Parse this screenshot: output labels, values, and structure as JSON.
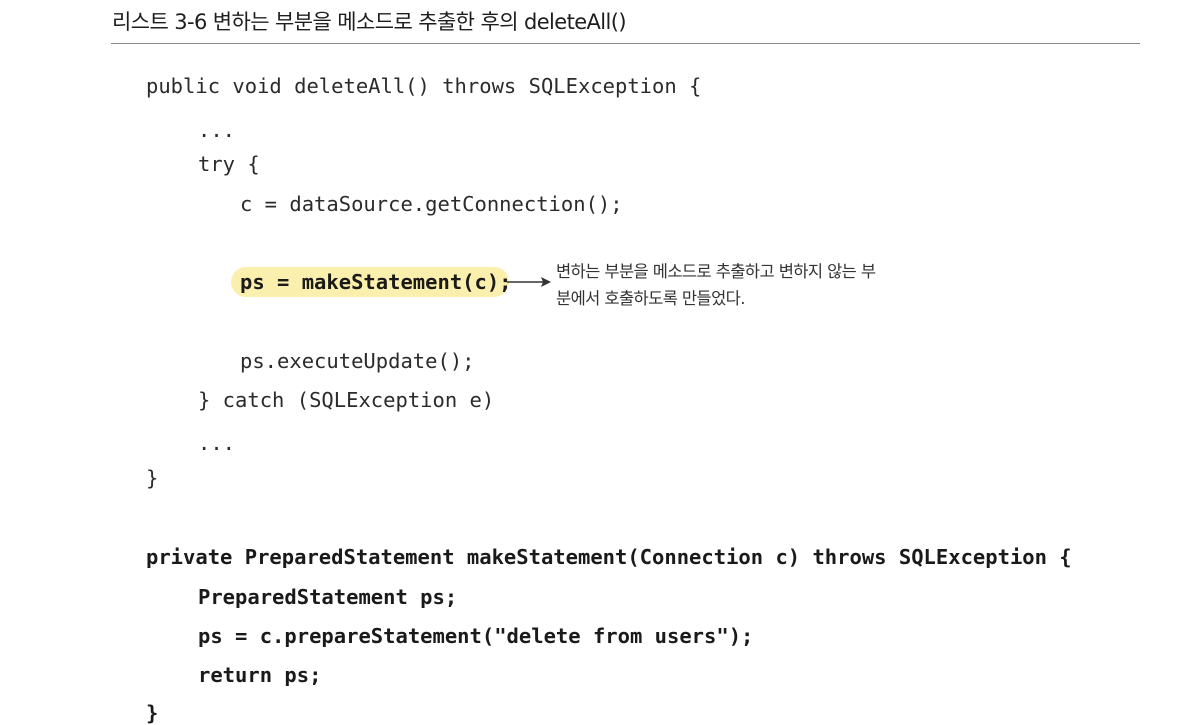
{
  "listing": {
    "title": "리스트 3-6 변하는 부분을 메소드로 추출한 후의 deleteAll()"
  },
  "code": {
    "delete_all": {
      "signature": "public void deleteAll() throws SQLException {",
      "ellipsis_1": "...",
      "try_open": "try {",
      "get_connection": "c = dataSource.getConnection();",
      "make_statement": "ps = makeStatement(c);",
      "execute_update": "ps.executeUpdate();",
      "catch_clause": "} catch (SQLException e)",
      "ellipsis_2": "...",
      "close_brace": "}"
    },
    "make_statement_method": {
      "signature": "private PreparedStatement makeStatement(Connection c) throws SQLException {",
      "declare_ps": "PreparedStatement ps;",
      "prepare": "ps = c.prepareStatement(\"delete from users\");",
      "return_stmt": "return ps;",
      "close_brace": "}"
    }
  },
  "annotation": {
    "line_1": "변하는 부분을 메소드로 추출하고 변하지 않는 부",
    "line_2": "분에서 호출하도록 만들었다."
  },
  "colors": {
    "highlight": "#fbefad",
    "rule": "#8a8a8a",
    "text": "#222222"
  }
}
